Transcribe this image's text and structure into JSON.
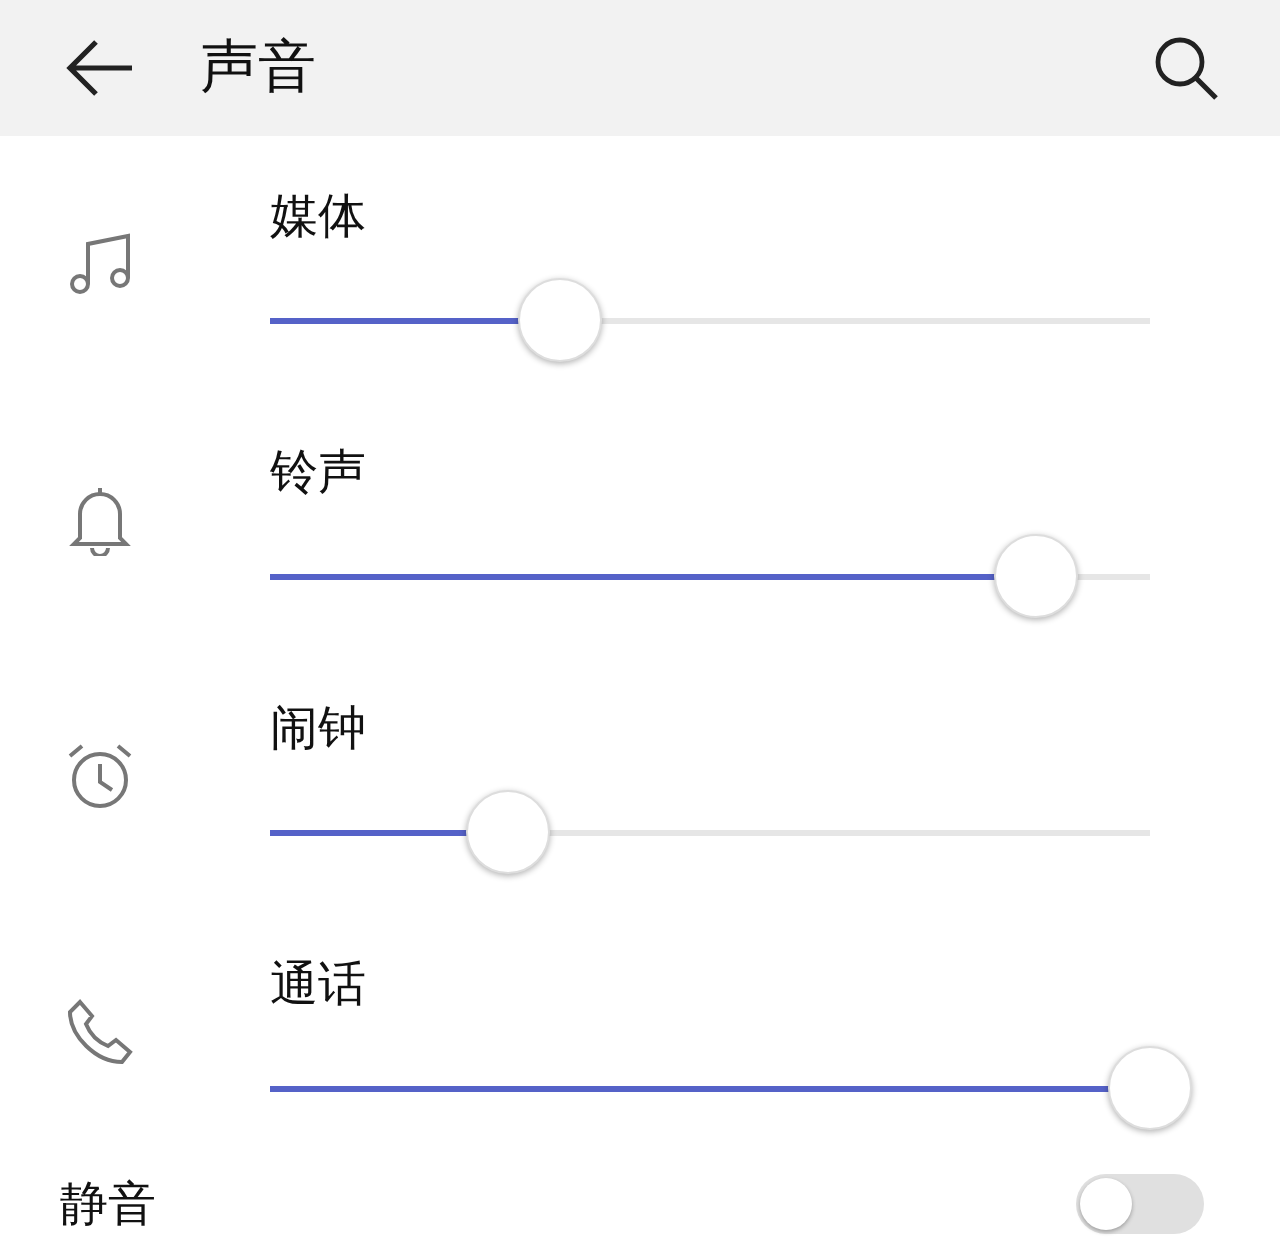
{
  "header": {
    "title": "声音"
  },
  "channels": [
    {
      "kind": "music",
      "name": "媒体",
      "level": 0.33
    },
    {
      "kind": "bell",
      "name": "铃声",
      "level": 0.87
    },
    {
      "kind": "alarm",
      "name": "闹钟",
      "level": 0.27
    },
    {
      "kind": "phone",
      "name": "通话",
      "level": 1.0
    }
  ],
  "silent": {
    "label": "静音",
    "on": false
  }
}
